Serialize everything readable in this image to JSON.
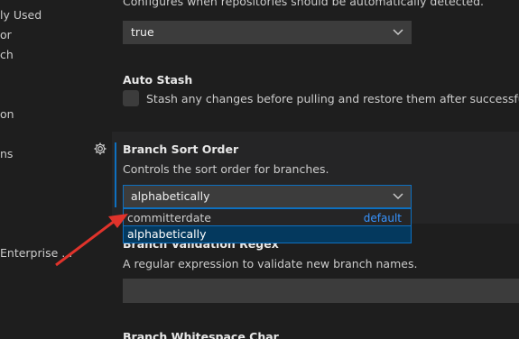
{
  "toc": {
    "items": [
      {
        "label": "ly Used"
      },
      {
        "label": "or"
      },
      {
        "label": "ch"
      },
      {
        "label": "on"
      },
      {
        "label": "ns"
      },
      {
        "label": "Enterprise ..."
      }
    ]
  },
  "auto_detect": {
    "description": "Configures when repositories should be automatically detected.",
    "value": "true"
  },
  "auto_stash": {
    "title": "Auto Stash",
    "description": "Stash any changes before pulling and restore them after successful pull."
  },
  "branch_sort": {
    "title": "Branch Sort Order",
    "description": "Controls the sort order for branches.",
    "value": "alphabetically",
    "options": [
      {
        "label": "committerdate",
        "tag": "default"
      },
      {
        "label": "alphabetically"
      }
    ]
  },
  "branch_validation": {
    "title": "Branch Validation Regex",
    "description": "A regular expression to validate new branch names.",
    "value": ""
  },
  "branch_whitespace": {
    "title": "Branch Whitespace Char"
  },
  "colors": {
    "accent": "#0e70c0",
    "link": "#3794ff",
    "annotation_arrow": "#e0332b"
  }
}
